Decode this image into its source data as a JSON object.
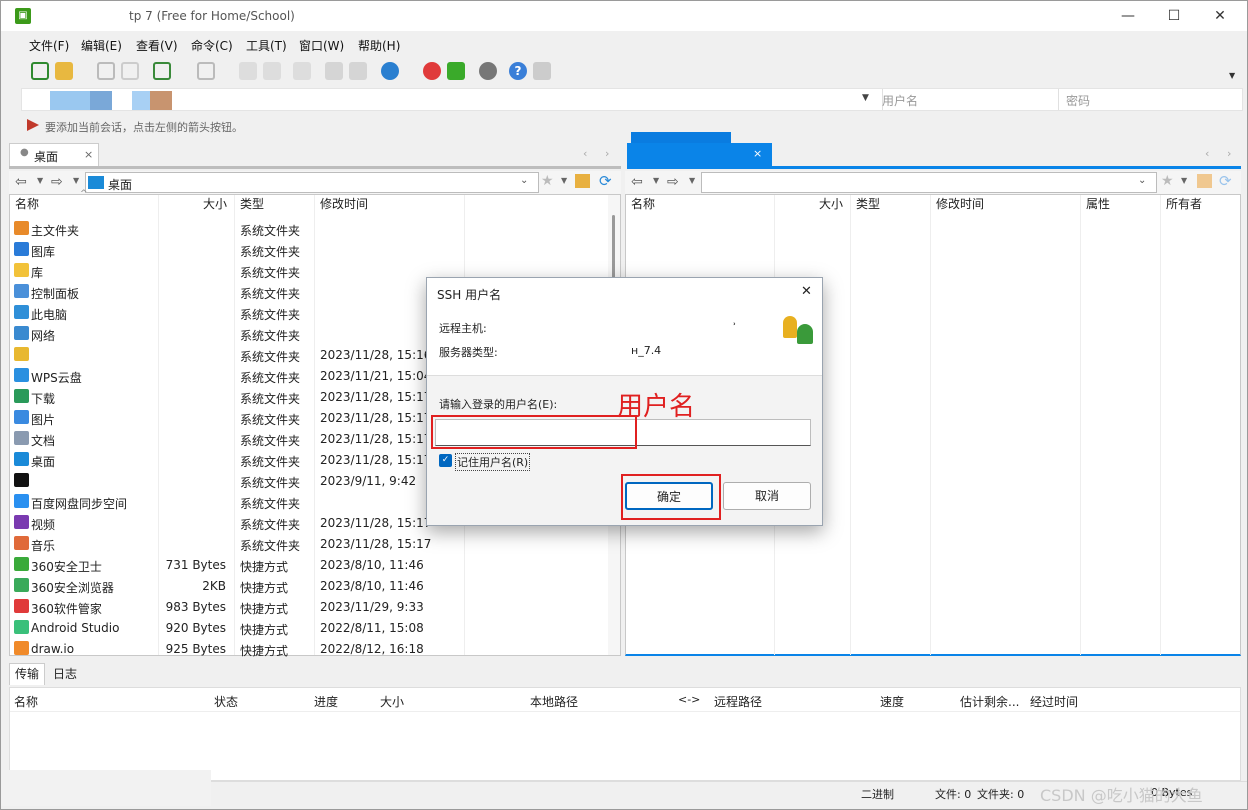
{
  "window": {
    "title": "tp 7 (Free for Home/School)",
    "icon": "winscp-app-icon"
  },
  "menu": [
    "文件(F)",
    "编辑(E)",
    "查看(V)",
    "命令(C)",
    "工具(T)",
    "窗口(W)",
    "帮助(H)"
  ],
  "session_bar": {
    "username_placeholder": "用户名",
    "password_placeholder": "密码"
  },
  "hint": "要添加当前会话，点击左侧的箭头按钮。",
  "left_tab": {
    "label": "桌面",
    "close": "×"
  },
  "right_tab": {
    "close": "×"
  },
  "left_path": "桌面",
  "left_columns": [
    "名称",
    "大小",
    "类型",
    "修改时间"
  ],
  "right_columns": [
    "名称",
    "大小",
    "类型",
    "修改时间",
    "属性",
    "所有者"
  ],
  "files": [
    {
      "name": "主文件夹",
      "size": "",
      "type": "系统文件夹",
      "date": "",
      "icon": "home-icon",
      "color": "#e88a2a"
    },
    {
      "name": "图库",
      "size": "",
      "type": "系统文件夹",
      "date": "",
      "icon": "gallery-icon",
      "color": "#2a7bd8"
    },
    {
      "name": "库",
      "size": "",
      "type": "系统文件夹",
      "date": "",
      "icon": "folder-icon",
      "color": "#f2c23a"
    },
    {
      "name": "控制面板",
      "size": "",
      "type": "系统文件夹",
      "date": "",
      "icon": "control-panel-icon",
      "color": "#4a90d9"
    },
    {
      "name": "此电脑",
      "size": "",
      "type": "系统文件夹",
      "date": "",
      "icon": "computer-icon",
      "color": "#2f8fd8"
    },
    {
      "name": "网络",
      "size": "",
      "type": "系统文件夹",
      "date": "",
      "icon": "network-icon",
      "color": "#3a8ad0"
    },
    {
      "name": "",
      "size": "",
      "type": "系统文件夹",
      "date": "2023/11/28, 15:16",
      "icon": "user-folder-icon",
      "color": "#e8b830"
    },
    {
      "name": "WPS云盘",
      "size": "",
      "type": "系统文件夹",
      "date": "2023/11/21, 15:04",
      "icon": "cloud-icon",
      "color": "#2a90e0"
    },
    {
      "name": "下载",
      "size": "",
      "type": "系统文件夹",
      "date": "2023/11/28, 15:17",
      "icon": "download-icon",
      "color": "#2a9a5a"
    },
    {
      "name": "图片",
      "size": "",
      "type": "系统文件夹",
      "date": "2023/11/28, 15:17",
      "icon": "pictures-icon",
      "color": "#3a8ae0"
    },
    {
      "name": "文档",
      "size": "",
      "type": "系统文件夹",
      "date": "2023/11/28, 15:17",
      "icon": "documents-icon",
      "color": "#8a9ab0"
    },
    {
      "name": "桌面",
      "size": "",
      "type": "系统文件夹",
      "date": "2023/11/28, 15:17",
      "icon": "desktop-icon",
      "color": "#1a8ad8"
    },
    {
      "name": "",
      "size": "",
      "type": "系统文件夹",
      "date": "2023/9/11, 9:42",
      "icon": "redacted-icon",
      "color": "#111111"
    },
    {
      "name": "百度网盘同步空间",
      "size": "",
      "type": "系统文件夹",
      "date": "",
      "icon": "baidu-netdisk-icon",
      "color": "#2a90f0"
    },
    {
      "name": "视频",
      "size": "",
      "type": "系统文件夹",
      "date": "2023/11/28, 15:17",
      "icon": "video-icon",
      "color": "#7a3ab0"
    },
    {
      "name": "音乐",
      "size": "",
      "type": "系统文件夹",
      "date": "2023/11/28, 15:17",
      "icon": "music-icon",
      "color": "#e06a3a"
    },
    {
      "name": "360安全卫士",
      "size": "731 Bytes",
      "type": "快捷方式",
      "date": "2023/8/10, 11:46",
      "icon": "360-safe-icon",
      "color": "#3aaa3a"
    },
    {
      "name": "360安全浏览器",
      "size": "2KB",
      "type": "快捷方式",
      "date": "2023/8/10, 11:46",
      "icon": "360-browser-icon",
      "color": "#3aaa5a"
    },
    {
      "name": "360软件管家",
      "size": "983 Bytes",
      "type": "快捷方式",
      "date": "2023/11/29, 9:33",
      "icon": "360-software-icon",
      "color": "#e03a3a"
    },
    {
      "name": "Android Studio",
      "size": "920 Bytes",
      "type": "快捷方式",
      "date": "2022/8/11, 15:08",
      "icon": "android-studio-icon",
      "color": "#3ac07a"
    },
    {
      "name": "draw.io",
      "size": "925 Bytes",
      "type": "快捷方式",
      "date": "2022/8/12, 16:18",
      "icon": "drawio-icon",
      "color": "#f08a2a"
    }
  ],
  "dialog": {
    "title": "SSH 用户名",
    "close": "✕",
    "remote_host_label": "远程主机:",
    "remote_host_value": "˒",
    "server_type_label": "服务器类型:",
    "server_type_value": "͏ʜ_7.4",
    "prompt": "请输入登录的用户名(E):",
    "annotation": "用户名",
    "username_value": "",
    "remember_label": "记住用户名(R)",
    "ok": "确定",
    "cancel": "取消"
  },
  "bottom_tabs": [
    "传输",
    "日志"
  ],
  "transfer_columns": [
    "名称",
    "状态",
    "进度",
    "大小",
    "本地路径",
    "<->",
    "远程路径",
    "速度",
    "估计剩余...",
    "经过时间"
  ],
  "status": {
    "mode": "二进制",
    "files": "文件: 0",
    "folders": "文件夹: 0",
    "bytes": "0 Bytes"
  },
  "watermark": "CSDN @吃小猫的大鱼",
  "colors": {
    "accent": "#0078d7",
    "annotation": "#e02020",
    "tab_active": "#1a86e8"
  }
}
